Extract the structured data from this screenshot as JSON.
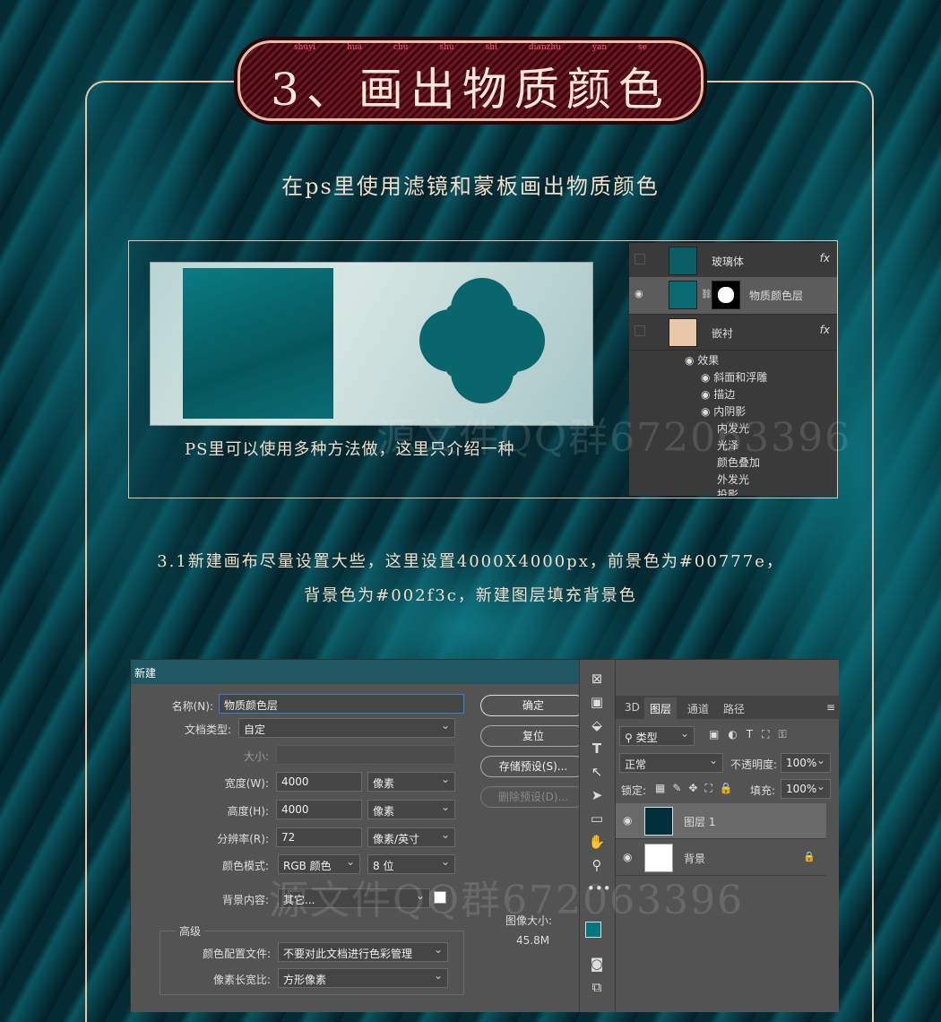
{
  "title": {
    "text": "3、画出物质颜色",
    "pinyin": [
      "shuyi",
      "hua",
      "chu",
      "shu",
      "shi",
      "dianzhu",
      "yan",
      "se"
    ]
  },
  "subtitle": "在ps里使用滤镜和蒙板画出物质颜色",
  "panel1": {
    "caption": "PS里可以使用多种方法做，这里只介绍一种",
    "layers": [
      {
        "name": "玻璃体",
        "fx": "fx"
      },
      {
        "name": "物质颜色层"
      },
      {
        "name": "嵌衬",
        "fx": "fx"
      }
    ],
    "effects_label": "效果",
    "effects": [
      "斜面和浮雕",
      "描边",
      "内阴影",
      "内发光",
      "光泽",
      "颜色叠加",
      "外发光",
      "投影"
    ]
  },
  "step": {
    "line1": "3.1新建画布尽量设置大些，这里设置4000X4000px，前景色为#00777e，",
    "line2": "背景色为#002f3c，新建图层填充背景色"
  },
  "watermark": "源文件QQ群672063396",
  "dialog": {
    "title": "新建",
    "name_label": "名称(N):",
    "name_value": "物质颜色层",
    "doctype_label": "文档类型:",
    "doctype_value": "自定",
    "size_label": "大小:",
    "width_label": "宽度(W):",
    "width_value": "4000",
    "width_unit": "像素",
    "height_label": "高度(H):",
    "height_value": "4000",
    "height_unit": "像素",
    "res_label": "分辨率(R):",
    "res_value": "72",
    "res_unit": "像素/英寸",
    "mode_label": "颜色模式:",
    "mode_value": "RGB 颜色",
    "bit_value": "8 位",
    "bg_label": "背景内容:",
    "bg_value": "其它...",
    "advanced_label": "高级",
    "profile_label": "颜色配置文件:",
    "profile_value": "不要对此文档进行色彩管理",
    "aspect_label": "像素长宽比:",
    "aspect_value": "方形像素",
    "buttons": {
      "ok": "确定",
      "reset": "复位",
      "save": "存储预设(S)...",
      "delete": "删除预设(D)..."
    },
    "image_size_label": "图像大小:",
    "image_size_value": "45.8M"
  },
  "right_panel": {
    "tabs": [
      "3D",
      "图层",
      "通道",
      "路径"
    ],
    "filter_value": "类型",
    "blend_value": "正常",
    "opacity_label": "不透明度:",
    "opacity_value": "100%",
    "lock_label": "锁定:",
    "fill_label": "填充:",
    "fill_value": "100%",
    "layers": [
      {
        "name": "图层 1"
      },
      {
        "name": "背景"
      }
    ]
  },
  "colors": {
    "foreground": "#00777e",
    "background": "#002f3c",
    "frame": "#e8c3a8"
  }
}
